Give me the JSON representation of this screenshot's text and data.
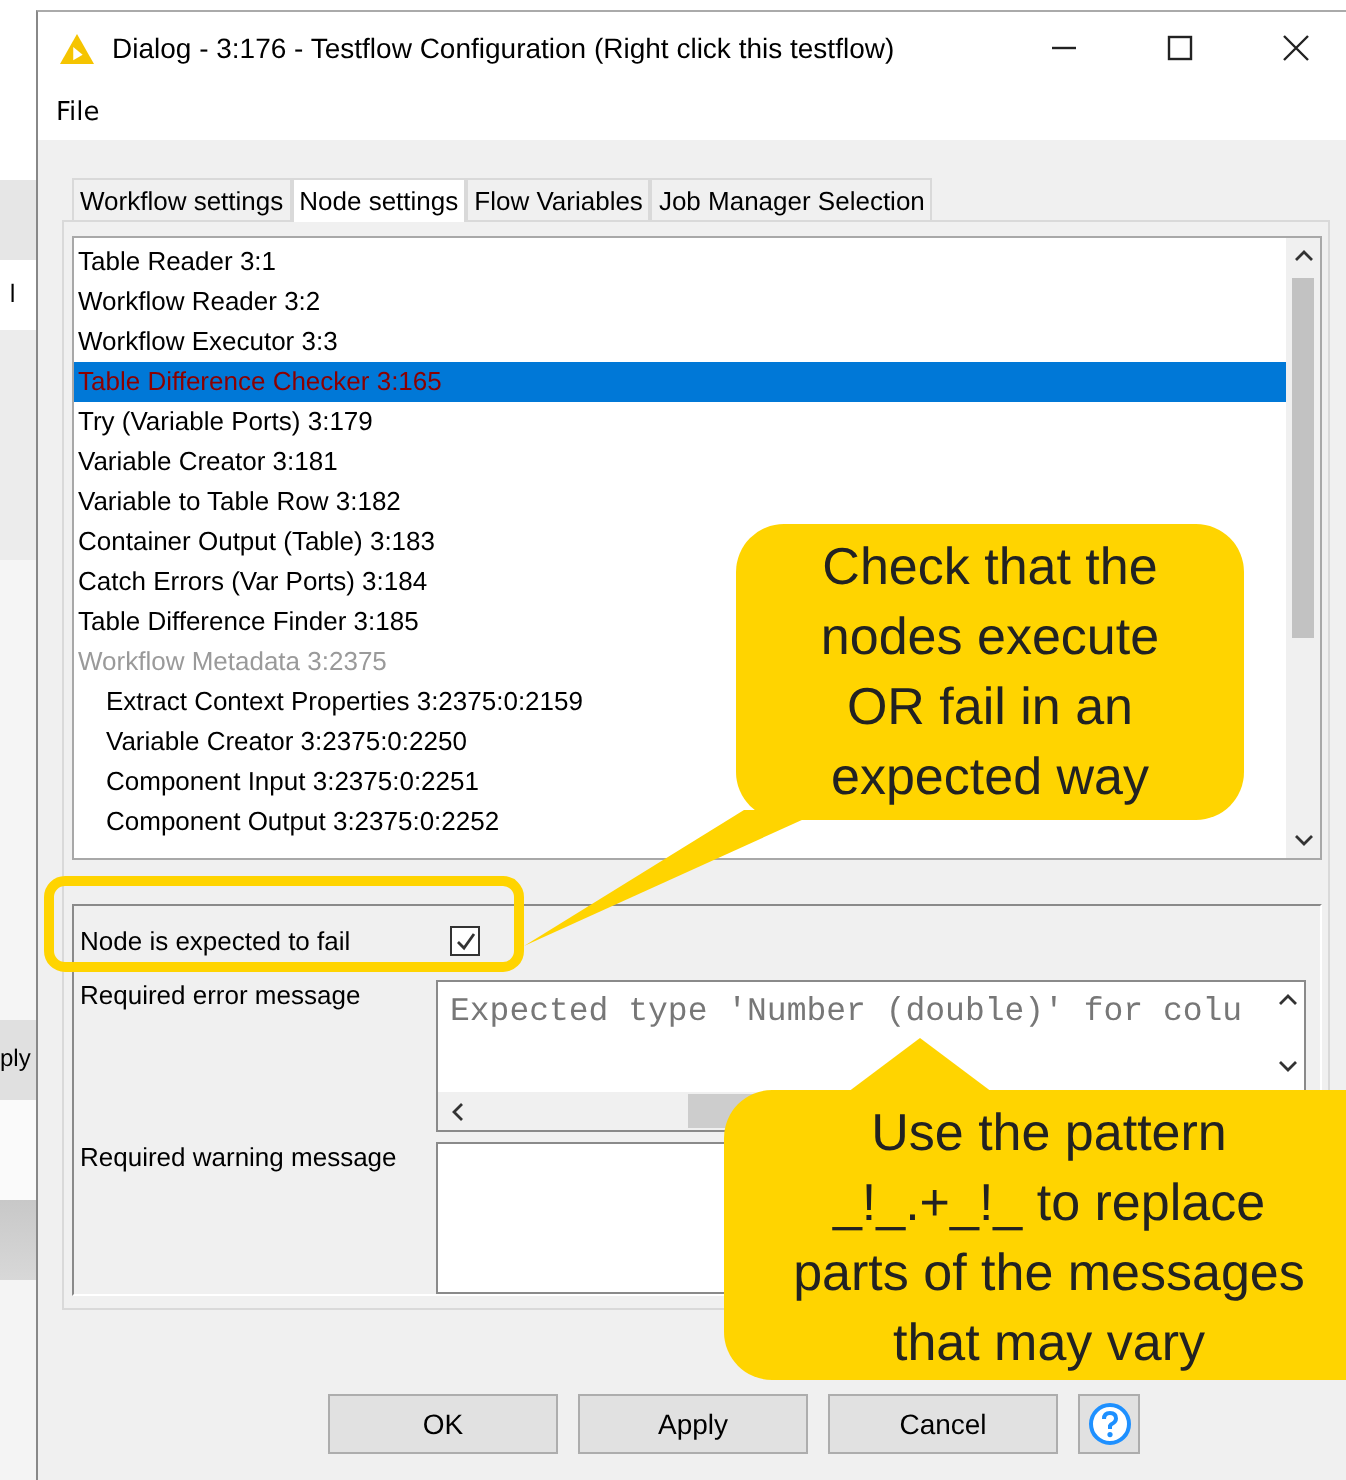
{
  "background": {
    "texts": [
      "l",
      "ply"
    ]
  },
  "window": {
    "title": "Dialog - 3:176 - Testflow Configuration (Right click this testflow)"
  },
  "menu": [
    "File"
  ],
  "tabs": [
    {
      "label": "Workflow settings",
      "selected": false
    },
    {
      "label": "Node settings",
      "selected": true
    },
    {
      "label": "Flow Variables",
      "selected": false
    },
    {
      "label": "Job Manager Selection",
      "selected": false
    }
  ],
  "node_list": [
    {
      "text": "Table Reader 3:1",
      "selected": false,
      "disabled": false
    },
    {
      "text": "Workflow Reader 3:2",
      "selected": false,
      "disabled": false
    },
    {
      "text": "Workflow Executor 3:3",
      "selected": false,
      "disabled": false
    },
    {
      "text": "Table Difference Checker 3:165",
      "selected": true,
      "disabled": false
    },
    {
      "text": "Try (Variable Ports) 3:179",
      "selected": false,
      "disabled": false
    },
    {
      "text": "Variable Creator 3:181",
      "selected": false,
      "disabled": false
    },
    {
      "text": "Variable to Table Row 3:182",
      "selected": false,
      "disabled": false
    },
    {
      "text": "Container Output (Table) 3:183",
      "selected": false,
      "disabled": false
    },
    {
      "text": "Catch Errors (Var Ports) 3:184",
      "selected": false,
      "disabled": false
    },
    {
      "text": "Table Difference Finder 3:185",
      "selected": false,
      "disabled": false
    },
    {
      "text": "Workflow Metadata 3:2375",
      "selected": false,
      "disabled": true,
      "children": [
        {
          "text": "Extract Context Properties 3:2375:0:2159",
          "selected": false,
          "disabled": false
        },
        {
          "text": "Variable Creator 3:2375:0:2250",
          "selected": false,
          "disabled": false
        },
        {
          "text": "Component Input 3:2375:0:2251",
          "selected": false,
          "disabled": false
        },
        {
          "text": "Component Output 3:2375:0:2252",
          "selected": false,
          "disabled": false
        }
      ]
    }
  ],
  "expected_to_fail": {
    "label": "Node is expected to fail",
    "checked": true
  },
  "error_message": {
    "label": "Required error message",
    "value": "Expected type 'Number (double)' for colu"
  },
  "warning_message": {
    "label": "Required warning message"
  },
  "buttons": [
    "OK",
    "Apply",
    "Cancel"
  ],
  "callouts": [
    "Check that the\nnodes execute\nOR fail in an\nexpected way",
    "Use the pattern\n_!_.+_!_ to replace\nparts of the messages\nthat may vary"
  ]
}
